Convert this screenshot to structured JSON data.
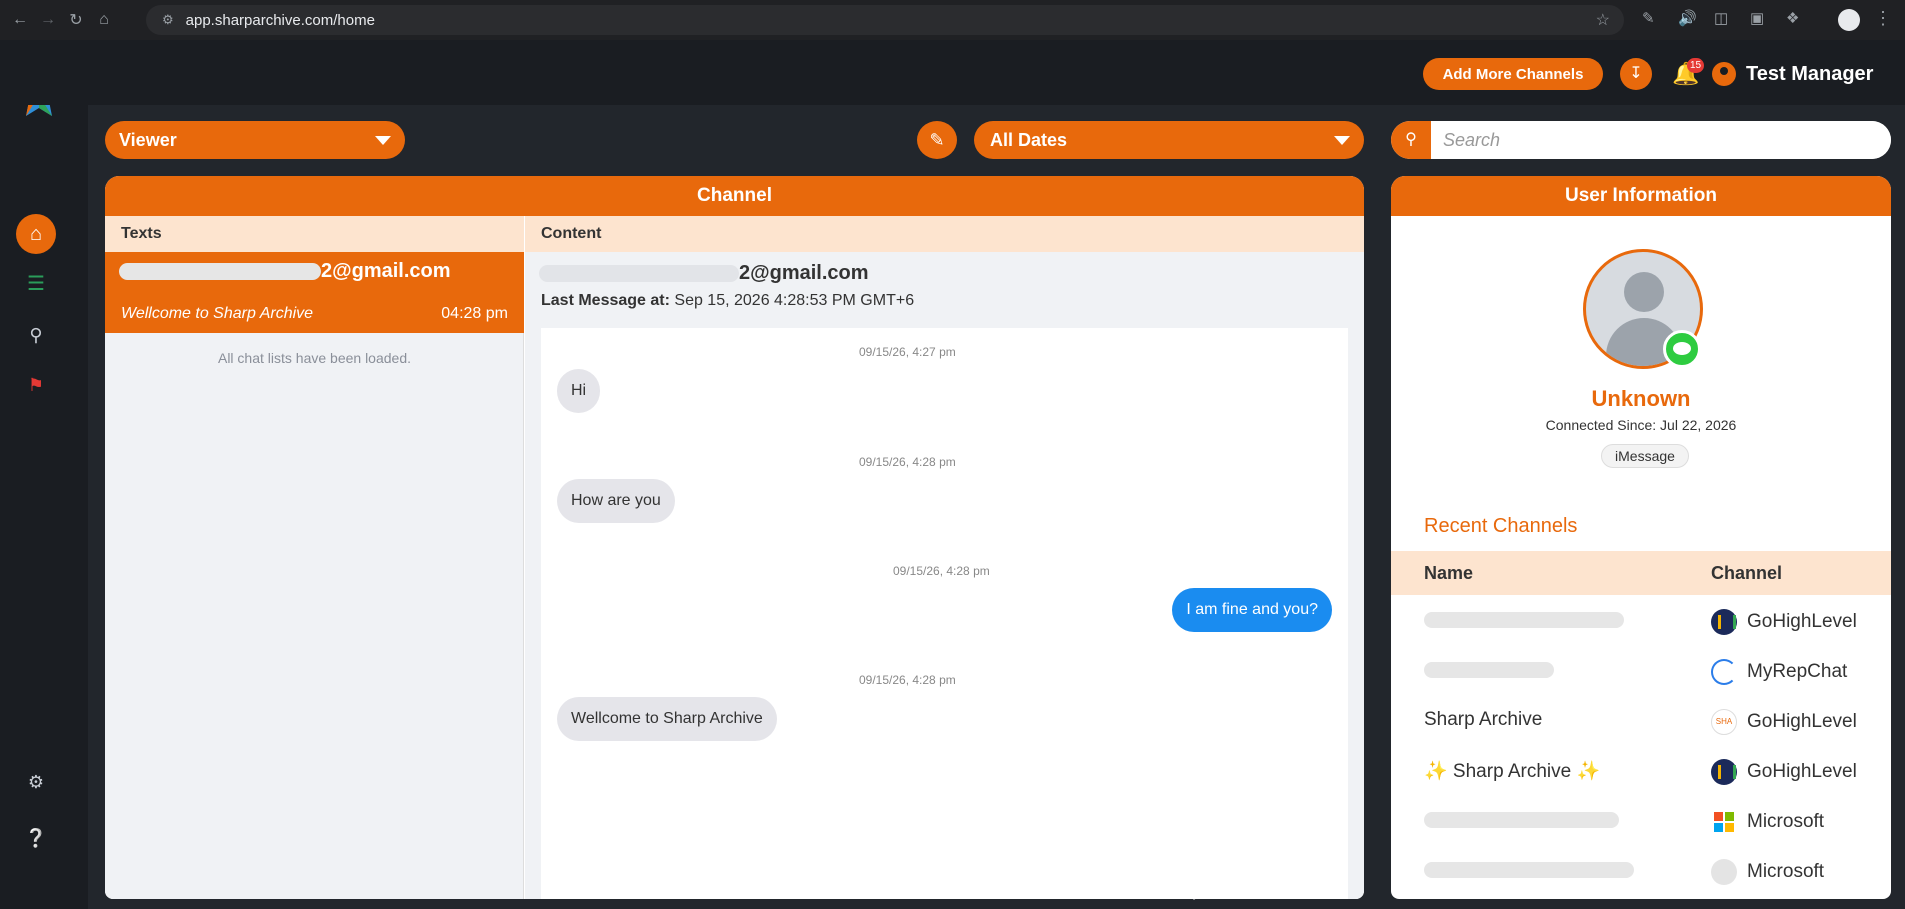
{
  "browser": {
    "url": "app.sharparchive.com/home"
  },
  "topbar": {
    "add_channels_label": "Add More Channels",
    "notification_count": "15",
    "user_name": "Test Manager"
  },
  "filters": {
    "viewer_label": "Viewer",
    "dates_label": "All Dates",
    "search_placeholder": "Search"
  },
  "channel_panel": {
    "title": "Channel",
    "texts_header": "Texts",
    "content_header": "Content",
    "chat_list": [
      {
        "email_suffix": "2@gmail.com",
        "preview": "Wellcome to Sharp Archive",
        "time": "04:28 pm"
      }
    ],
    "loaded_text": "All chat lists have been loaded.",
    "conversation": {
      "email_suffix": "2@gmail.com",
      "last_message_label": "Last Message at:",
      "last_message_value": "Sep 15, 2026 4:28:53 PM GMT+6",
      "messages": [
        {
          "timestamp": "09/15/26, 4:27 pm",
          "text": "Hi",
          "direction": "in"
        },
        {
          "timestamp": "09/15/26, 4:28 pm",
          "text": "How are you",
          "direction": "in"
        },
        {
          "timestamp": "09/15/26, 4:28 pm",
          "text": "I am fine and you?",
          "direction": "out"
        },
        {
          "timestamp": "09/15/26, 4:28 pm",
          "text": "Wellcome to Sharp Archive",
          "direction": "in"
        }
      ]
    }
  },
  "user_panel": {
    "title": "User Information",
    "name": "Unknown",
    "connected_since": "Connected Since: Jul 22, 2026",
    "channel_chip": "iMessage",
    "recent_title": "Recent Channels",
    "col_name": "Name",
    "col_channel": "Channel",
    "recent": [
      {
        "name": "",
        "channel": "GoHighLevel",
        "icon": "gohighlevel-icon"
      },
      {
        "name": "",
        "channel": "MyRepChat",
        "icon": "myrepchat-icon"
      },
      {
        "name": "Sharp Archive",
        "channel": "GoHighLevel",
        "icon": "sharp-archive-icon"
      },
      {
        "name": "✨ Sharp Archive ✨",
        "channel": "GoHighLevel",
        "icon": "gohighlevel-icon"
      },
      {
        "name": "",
        "channel": "Microsoft",
        "icon": "microsoft-icon"
      },
      {
        "name": "",
        "channel": "Microsoft",
        "icon": "blank-icon"
      }
    ]
  },
  "colors": {
    "accent": "#e8690c",
    "sidebar_bg": "#1a1d22",
    "outgoing_bubble": "#1a8cf0",
    "incoming_bubble": "#e5e5ea"
  }
}
